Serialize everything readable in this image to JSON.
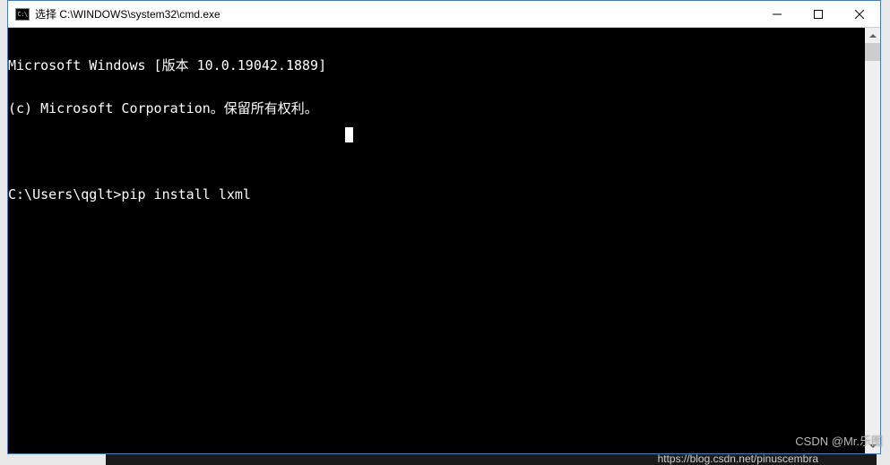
{
  "titlebar": {
    "icon_label": "C:\\",
    "title": "选择 C:\\WINDOWS\\system32\\cmd.exe"
  },
  "terminal": {
    "lines": [
      "Microsoft Windows [版本 10.0.19042.1889]",
      "(c) Microsoft Corporation。保留所有权利。",
      "",
      "C:\\Users\\qglt>pip install lxml"
    ]
  },
  "watermark": {
    "text": "CSDN @Mr.乐图"
  },
  "url_ghost": {
    "text": "https://blog.csdn.net/pinuscembra"
  }
}
